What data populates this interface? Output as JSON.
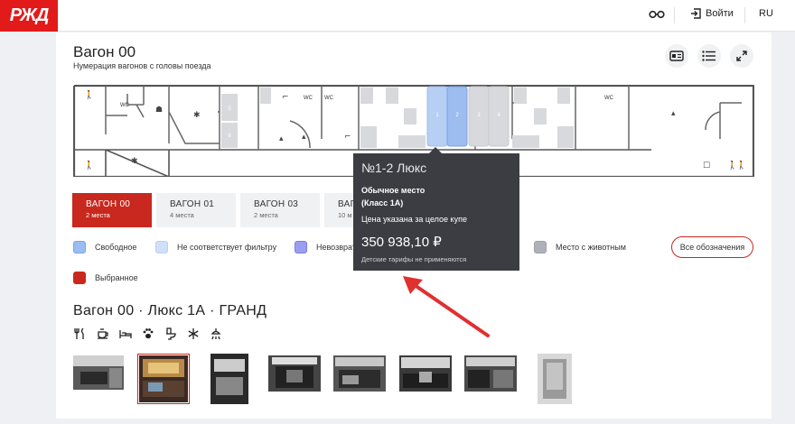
{
  "header": {
    "logo_text": "РЖД",
    "login_label": "Войти",
    "language": "RU",
    "brand_color": "#e21a1a"
  },
  "wagon": {
    "title": "Вагон 00",
    "subtitle": "Нумерация вагонов с головы поезда"
  },
  "scheme": {
    "wc_label": "WC",
    "seats_left_block": [
      "5",
      "6"
    ],
    "highlighted_seats": [
      "1",
      "2"
    ],
    "other_seats": [
      "3",
      "4"
    ]
  },
  "tabs": [
    {
      "label": "ВАГОН 00",
      "sub": "2 места",
      "active": true
    },
    {
      "label": "ВАГОН 01",
      "sub": "4 места",
      "active": false
    },
    {
      "label": "ВАГОН 03",
      "sub": "2 места",
      "active": false
    },
    {
      "label": "ВАГ",
      "sub": "10 м",
      "active": false
    }
  ],
  "legend": [
    {
      "label": "Свободное",
      "color": "#9dbcf0"
    },
    {
      "label": "Не соответствует фильтру",
      "color": "#cfe0f8"
    },
    {
      "label": "Невозвратн",
      "color": "#9a9ef0"
    },
    {
      "label": "Место с животным",
      "color": "#b0b0b8"
    },
    {
      "label": "Выбранное",
      "color": "#c8281e"
    }
  ],
  "legend_all_button": "Все обозначения",
  "section_title": "Вагон 00 · Люкс 1А · ГРАНД",
  "amenity_icons": [
    "restaurant-icon",
    "coffee-icon",
    "bed-icon",
    "pet-icon",
    "toilet-icon",
    "snowflake-icon",
    "shower-icon"
  ],
  "tooltip": {
    "title": "№1-2 Люкс",
    "seat_type": "Обычное место",
    "class": "(Класс 1А)",
    "price_note": "Цена указана за целое купе",
    "price": "350 938,10 ₽",
    "kids_note": "Детские тарифы не применяются"
  },
  "colors": {
    "accent": "#c8281e",
    "seat_free": "#9dbcf0",
    "seat_selected_hover": "#b8cff4",
    "tooltip_bg": "#3b3d42",
    "arrow": "#e03030"
  }
}
